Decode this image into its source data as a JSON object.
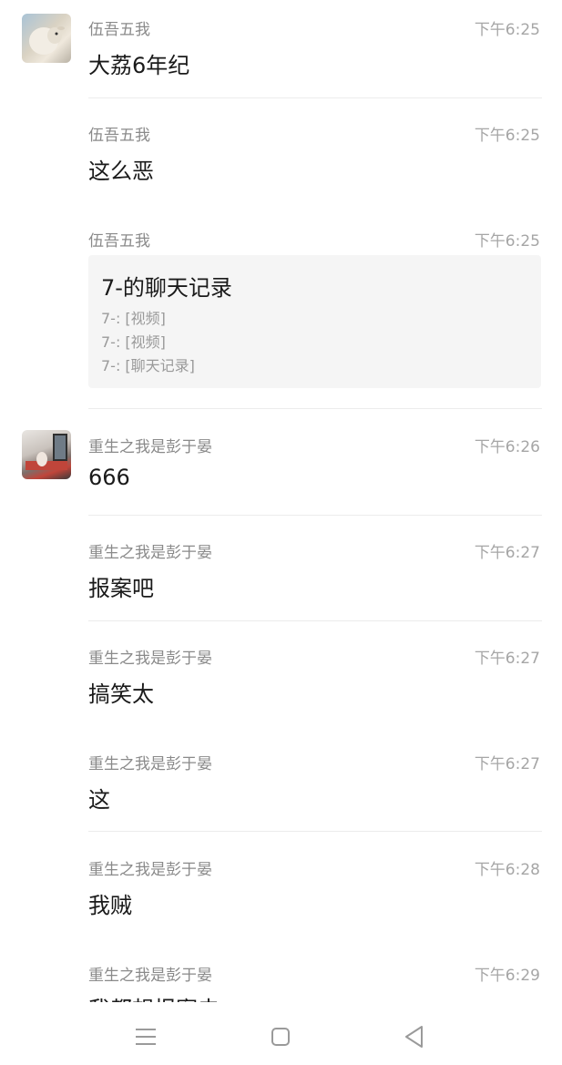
{
  "messages": [
    {
      "sender": "伍吾五我",
      "time": "下午6:25",
      "text": "大荔6年纪",
      "avatar": "sheep-avatar"
    },
    {
      "sender": "伍吾五我",
      "time": "下午6:25",
      "text": "这么恶"
    },
    {
      "sender": "伍吾五我",
      "time": "下午6:25",
      "card": {
        "title": "7-的聊天记录",
        "lines": [
          "7-: [视频]",
          "7-: [视频]",
          "7-: [聊天记录]"
        ]
      }
    },
    {
      "sender": "重生之我是彭于晏",
      "time": "下午6:26",
      "text": "666",
      "avatar": "room-avatar"
    },
    {
      "sender": "重生之我是彭于晏",
      "time": "下午6:27",
      "text": "报案吧"
    },
    {
      "sender": "重生之我是彭于晏",
      "time": "下午6:27",
      "text": "搞笑太"
    },
    {
      "sender": "重生之我是彭于晏",
      "time": "下午6:27",
      "text": "这"
    },
    {
      "sender": "重生之我是彭于晏",
      "time": "下午6:28",
      "text": "我贼"
    },
    {
      "sender": "重生之我是彭于晏",
      "time": "下午6:29",
      "text": "我都想报案去"
    }
  ],
  "navbar": {
    "icons": [
      "menu-icon",
      "home-square-icon",
      "back-triangle-icon"
    ],
    "icon_color": "#9a9a9a"
  }
}
